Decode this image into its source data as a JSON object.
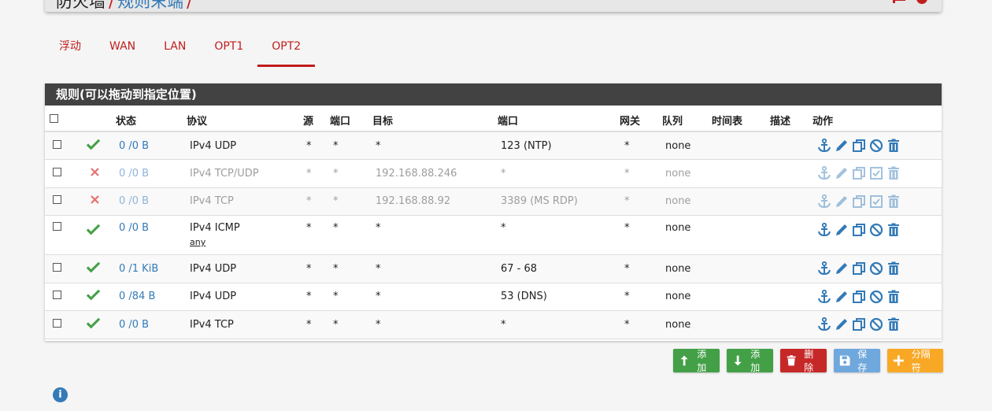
{
  "header": {
    "breadcrumb_root": "防火墙",
    "breadcrumb_child": "规则末端",
    "separator": "/"
  },
  "tabs": [
    {
      "label": "浮动",
      "active": false
    },
    {
      "label": "WAN",
      "active": false
    },
    {
      "label": "LAN",
      "active": false
    },
    {
      "label": "OPT1",
      "active": false
    },
    {
      "label": "OPT2",
      "active": true
    }
  ],
  "panel": {
    "title": "规则(可以拖动到指定位置)"
  },
  "columns": {
    "state": "状态",
    "protocol": "协议",
    "source": "源",
    "port": "端口",
    "destination": "目标",
    "dest_port": "端口",
    "gateway": "网关",
    "queue": "队列",
    "schedule": "时间表",
    "description": "描述",
    "actions": "动作"
  },
  "rows": [
    {
      "enabled": true,
      "state": "0 /0 B",
      "protocol": "IPv4 UDP",
      "sub": "",
      "source": "*",
      "port": "*",
      "destination": "*",
      "dest_port": "123 (NTP)",
      "gateway": "*",
      "queue": "none"
    },
    {
      "enabled": false,
      "state": "0 /0 B",
      "protocol": "IPv4 TCP/UDP",
      "sub": "",
      "source": "*",
      "port": "*",
      "destination": "192.168.88.246",
      "dest_port": "*",
      "gateway": "*",
      "queue": "none"
    },
    {
      "enabled": false,
      "state": "0 /0 B",
      "protocol": "IPv4 TCP",
      "sub": "",
      "source": "*",
      "port": "*",
      "destination": "192.168.88.92",
      "dest_port": "3389 (MS RDP)",
      "gateway": "*",
      "queue": "none"
    },
    {
      "enabled": true,
      "state": "0 /0 B",
      "protocol": "IPv4 ICMP",
      "sub": "any",
      "source": "*",
      "port": "*",
      "destination": "*",
      "dest_port": "*",
      "gateway": "*",
      "queue": "none"
    },
    {
      "enabled": true,
      "state": "0 /1 KiB",
      "protocol": "IPv4 UDP",
      "sub": "",
      "source": "*",
      "port": "*",
      "destination": "*",
      "dest_port": "67 - 68",
      "gateway": "*",
      "queue": "none"
    },
    {
      "enabled": true,
      "state": "0 /84 B",
      "protocol": "IPv4 UDP",
      "sub": "",
      "source": "*",
      "port": "*",
      "destination": "*",
      "dest_port": "53 (DNS)",
      "gateway": "*",
      "queue": "none"
    },
    {
      "enabled": true,
      "state": "0 /0 B",
      "protocol": "IPv4 TCP",
      "sub": "",
      "source": "*",
      "port": "*",
      "destination": "*",
      "dest_port": "*",
      "gateway": "*",
      "queue": "none"
    }
  ],
  "buttons": {
    "add_top": "添加",
    "add_bottom": "添加",
    "delete": "删除",
    "save": "保存",
    "separator": "分隔符"
  },
  "colors": {
    "accent_red": "#c21d1d",
    "link_blue": "#337ab7",
    "check_green": "#43a047",
    "cross_red": "#e57373",
    "panel_head": "#424242"
  },
  "icons": {
    "info": "i"
  }
}
